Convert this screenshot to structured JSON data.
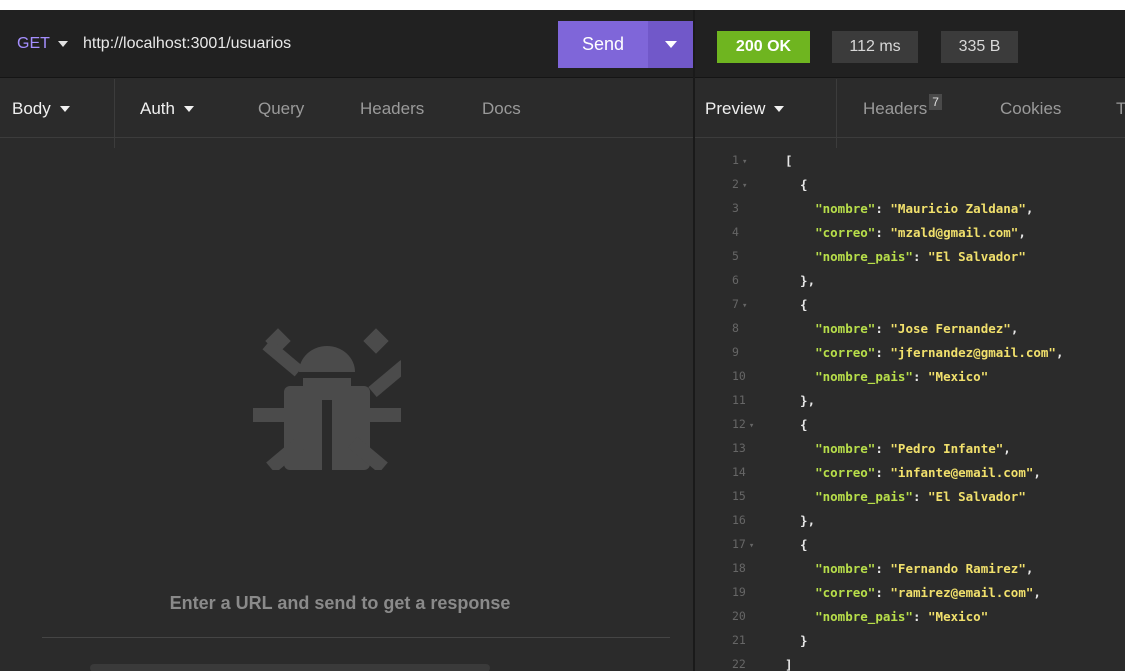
{
  "request": {
    "method": "GET",
    "url": "http://localhost:3001/usuarios",
    "send_label": "Send",
    "tabs": [
      "Body",
      "Auth",
      "Query",
      "Headers",
      "Docs"
    ],
    "empty_message": "Enter a URL and send to get a response"
  },
  "response": {
    "status": "200 OK",
    "time": "112 ms",
    "size": "335 B",
    "tabs": {
      "preview": "Preview",
      "headers": "Headers",
      "headers_count": "7",
      "cookies": "Cookies",
      "truncated": "T"
    },
    "lines": [
      {
        "n": "1",
        "fold": true,
        "text": "["
      },
      {
        "n": "2",
        "fold": true,
        "text": "  {"
      },
      {
        "n": "3",
        "key": "nombre",
        "value": "Mauricio Zaldana",
        "comma": true
      },
      {
        "n": "4",
        "key": "correo",
        "value": "mzald@gmail.com",
        "comma": true
      },
      {
        "n": "5",
        "key": "nombre_pais",
        "value": "El Salvador",
        "comma": false
      },
      {
        "n": "6",
        "text": "  },"
      },
      {
        "n": "7",
        "fold": true,
        "text": "  {"
      },
      {
        "n": "8",
        "key": "nombre",
        "value": "Jose Fernandez",
        "comma": true
      },
      {
        "n": "9",
        "key": "correo",
        "value": "jfernandez@gmail.com",
        "comma": true
      },
      {
        "n": "10",
        "key": "nombre_pais",
        "value": "Mexico",
        "comma": false
      },
      {
        "n": "11",
        "text": "  },"
      },
      {
        "n": "12",
        "fold": true,
        "text": "  {"
      },
      {
        "n": "13",
        "key": "nombre",
        "value": "Pedro Infante",
        "comma": true
      },
      {
        "n": "14",
        "key": "correo",
        "value": "infante@email.com",
        "comma": true
      },
      {
        "n": "15",
        "key": "nombre_pais",
        "value": "El Salvador",
        "comma": false
      },
      {
        "n": "16",
        "text": "  },"
      },
      {
        "n": "17",
        "fold": true,
        "text": "  {"
      },
      {
        "n": "18",
        "key": "nombre",
        "value": "Fernando Ramirez",
        "comma": true
      },
      {
        "n": "19",
        "key": "correo",
        "value": "ramirez@email.com",
        "comma": true
      },
      {
        "n": "20",
        "key": "nombre_pais",
        "value": "Mexico",
        "comma": false
      },
      {
        "n": "21",
        "text": "  }"
      },
      {
        "n": "22",
        "text": "]"
      }
    ]
  },
  "icons": {
    "method_dropdown": "caret-down-icon",
    "send_dropdown": "caret-down-icon",
    "empty_state": "bug-icon"
  },
  "colors": {
    "method": "#a58fff",
    "send": "#7f66d9",
    "status_ok": "#6fb520",
    "json_key": "#b8df4a",
    "json_string": "#f1e06c"
  }
}
